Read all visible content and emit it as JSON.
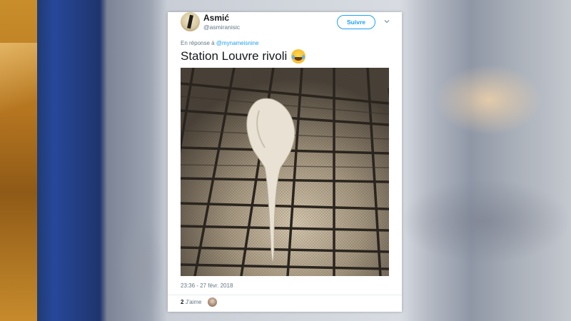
{
  "tweet": {
    "author_name": "Asmić",
    "author_handle": "@asmiranisic",
    "follow_label": "Suivre",
    "reply_prefix": "En réponse à",
    "reply_mention": "@mynameisnine",
    "text": "Station Louvre rivoli",
    "emoji": "face-with-tears-of-joy",
    "timestamp": "23:36 - 27 févr. 2018",
    "like_count": "2",
    "like_label": "J'aime"
  },
  "colors": {
    "accent": "#1da1f2",
    "text_primary": "#14171a",
    "text_secondary": "#657786"
  },
  "icons": {
    "menu": "chevron-down-icon",
    "avatar": "avatar",
    "emoji": "face-with-tears-of-joy-icon"
  }
}
